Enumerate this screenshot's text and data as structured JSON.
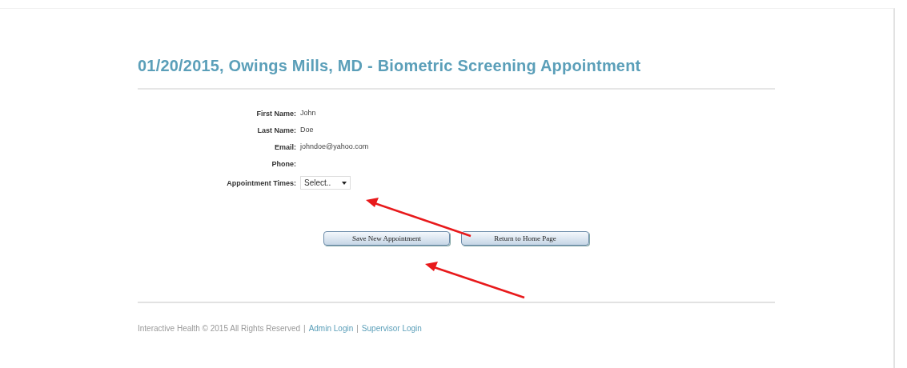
{
  "title": "01/20/2015, Owings Mills, MD - Biometric Screening Appointment",
  "fields": [
    {
      "label": "First Name:",
      "kind": "text",
      "value": "John"
    },
    {
      "label": "Last Name:",
      "kind": "text",
      "value": "Doe"
    },
    {
      "label": "Email:",
      "kind": "text",
      "value": "johndoe@yahoo.com"
    },
    {
      "label": "Phone:",
      "kind": "text"
    },
    {
      "label": "Appointment Times:",
      "kind": "select",
      "value": "Select.."
    }
  ],
  "buttons": [
    "Save New Appointment",
    "Return to Home Page"
  ],
  "footer": [
    {
      "kind": "text",
      "text": "Interactive Health © 2015 All Rights Reserved"
    },
    {
      "kind": "separator",
      "text": "|"
    },
    {
      "kind": "link",
      "text": "Admin Login"
    },
    {
      "kind": "separator",
      "text": "|"
    },
    {
      "kind": "link",
      "text": "Supervisor Login"
    }
  ]
}
